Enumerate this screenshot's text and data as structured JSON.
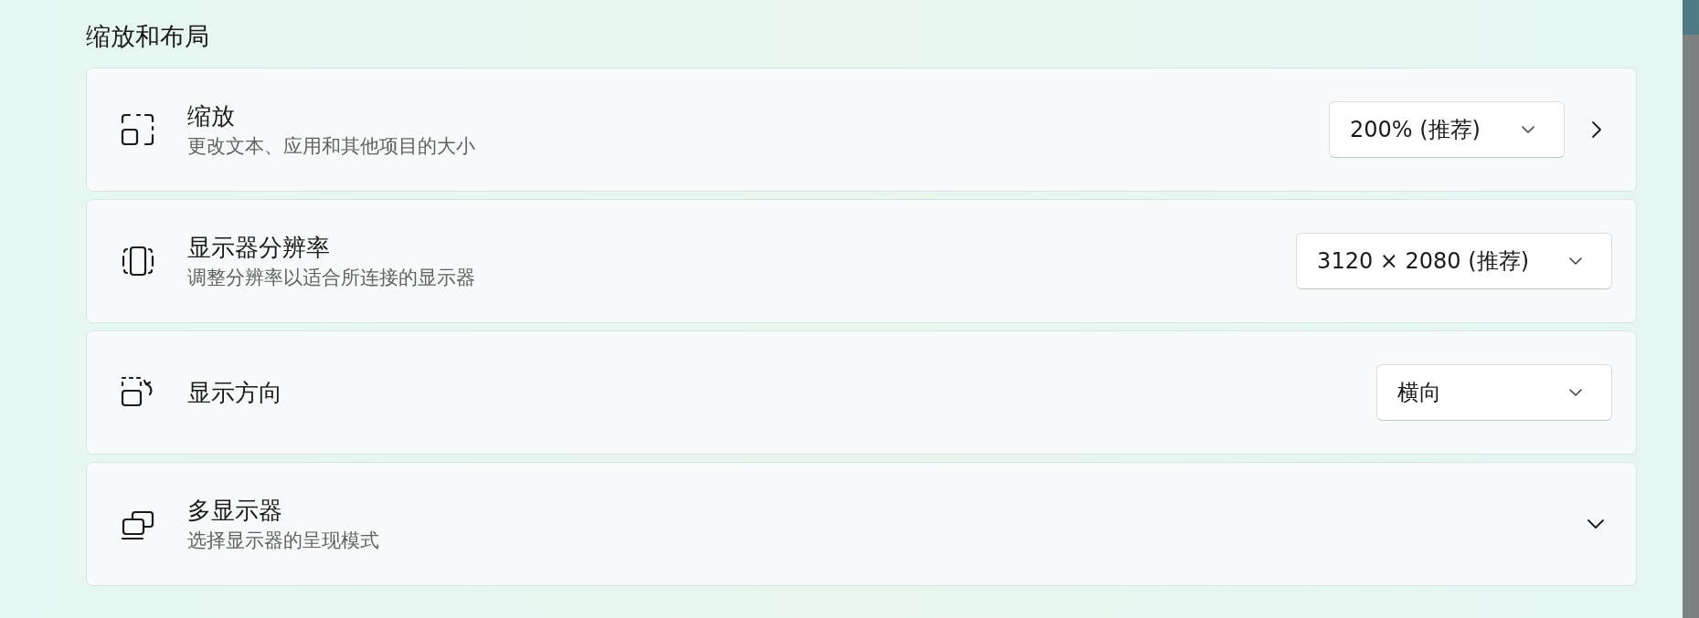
{
  "section_title": "缩放和布局",
  "settings": [
    {
      "kind": "dropdown",
      "title": "缩放",
      "subtitle": "更改文本、应用和其他项目的大小",
      "value": "200% (推荐)",
      "navigates": true
    },
    {
      "kind": "dropdown",
      "title": "显示器分辨率",
      "subtitle": "调整分辨率以适合所连接的显示器",
      "value": "3120 × 2080 (推荐)",
      "navigates": false
    },
    {
      "kind": "dropdown",
      "title": "显示方向",
      "value": "横向",
      "navigates": false
    },
    {
      "kind": "expander",
      "title": "多显示器",
      "subtitle": "选择显示器的呈现模式",
      "expanded": false
    }
  ]
}
